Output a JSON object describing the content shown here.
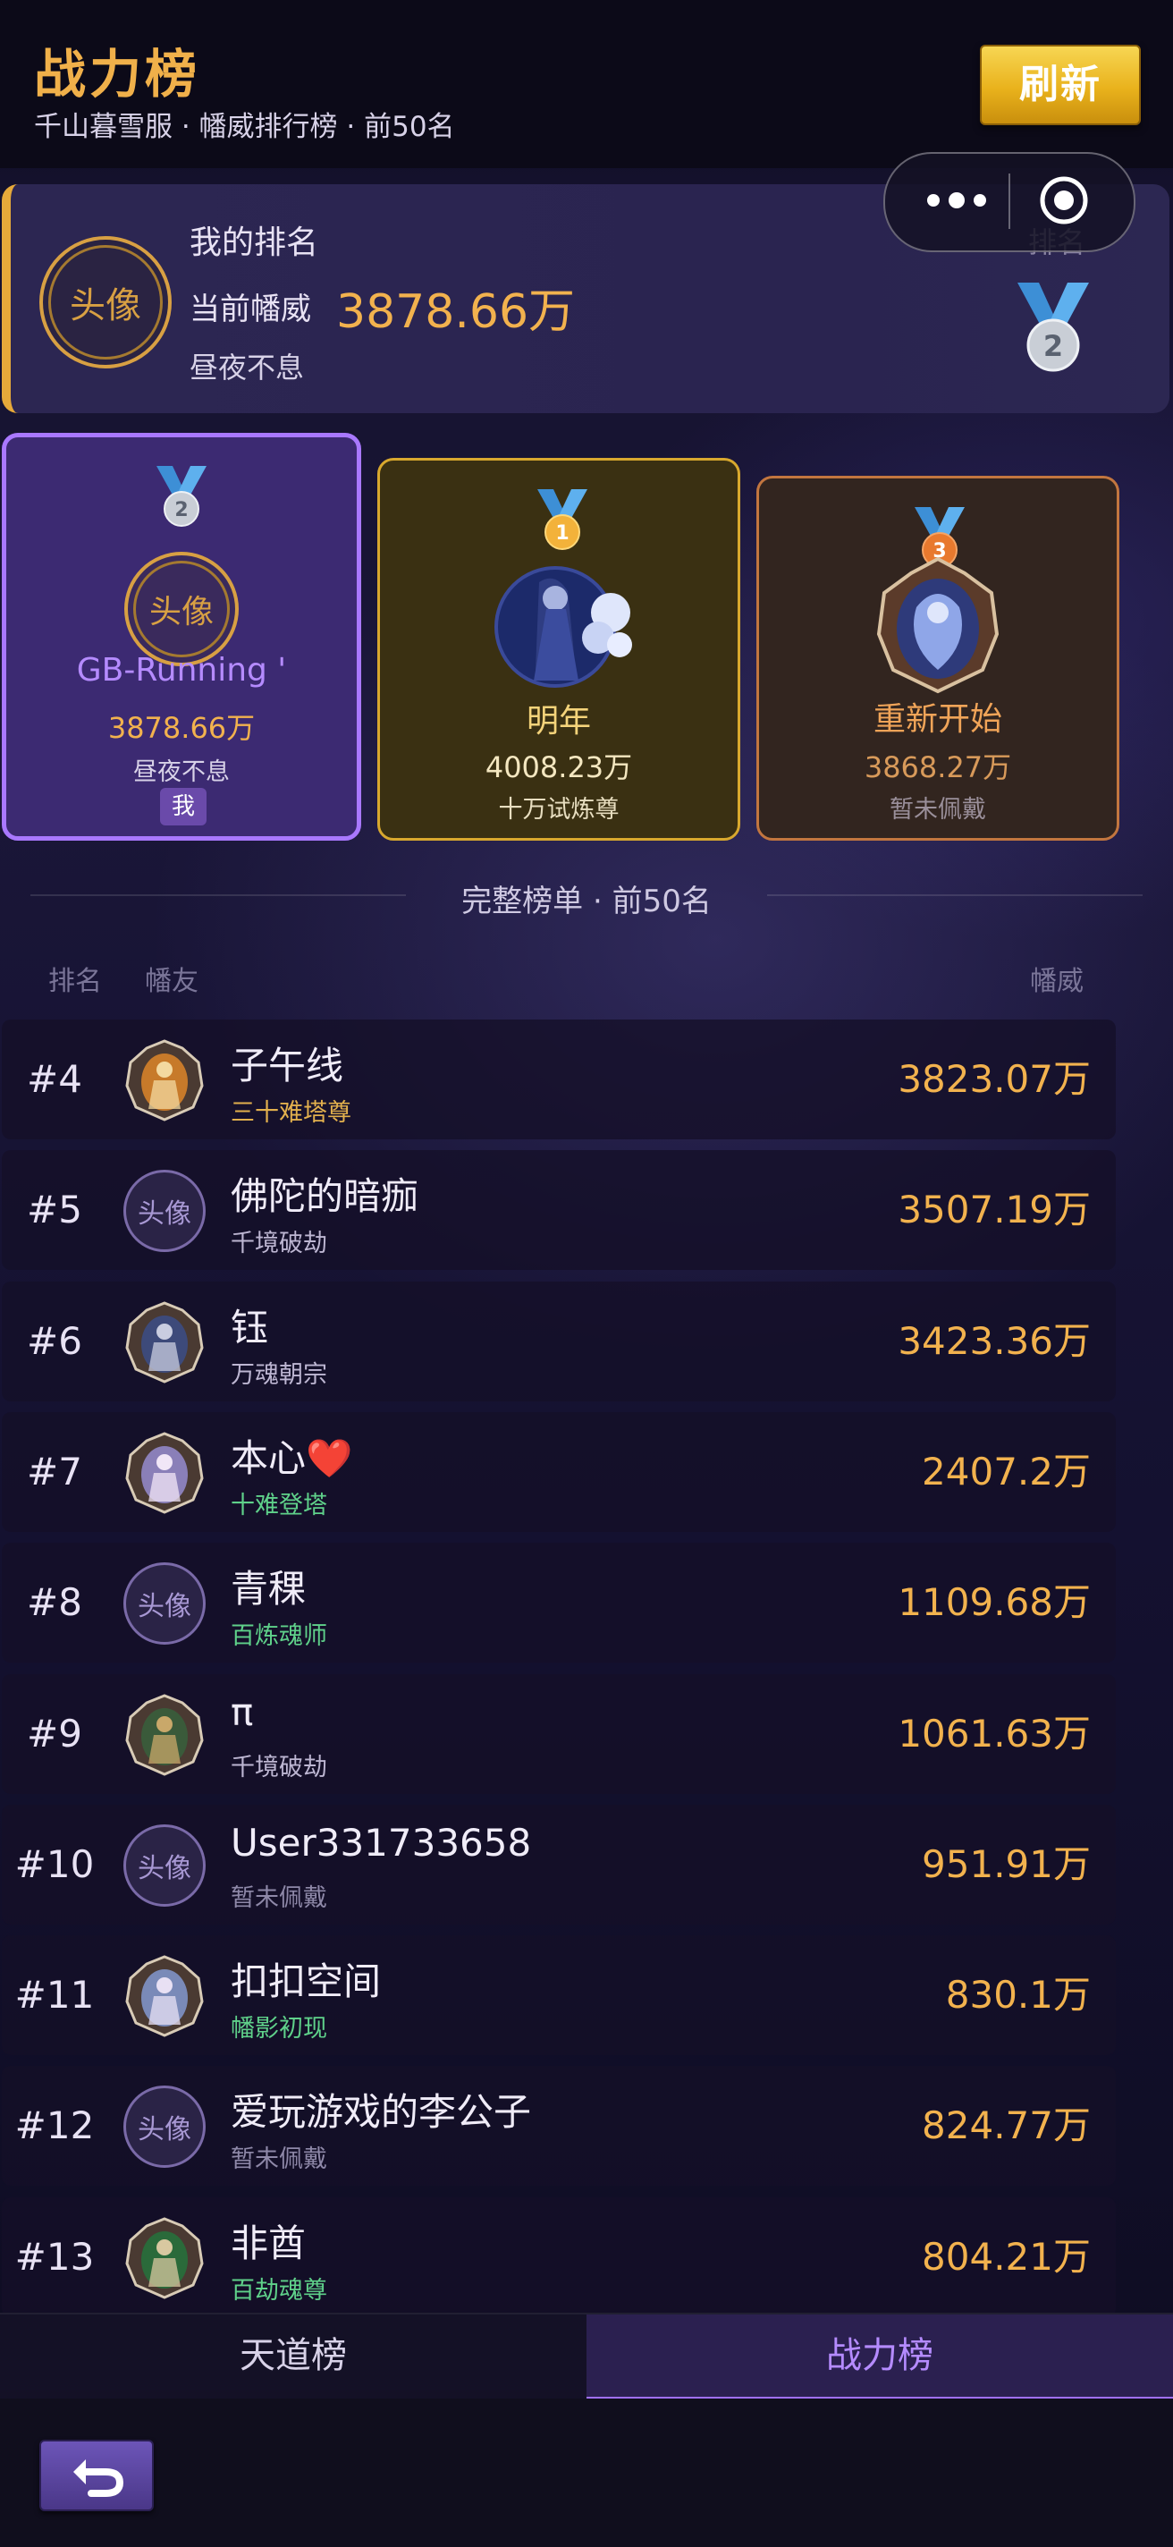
{
  "header": {
    "title": "战力榜",
    "subtitle": "千山暮雪服 · 幡威排行榜 · 前50名",
    "refresh_label": "刷新"
  },
  "my_rank": {
    "label": "我的排名",
    "power_label": "当前幡威",
    "power_value": "3878.66万",
    "title": "昼夜不息",
    "avatar_text": "头像",
    "rank_label": "排名",
    "rank_number": "2"
  },
  "podium": [
    {
      "rank": "2",
      "name": "GB-Running '",
      "power": "3878.66万",
      "title": "昼夜不息",
      "avatar_text": "头像",
      "me_badge": "我"
    },
    {
      "rank": "1",
      "name": "明年",
      "power": "4008.23万",
      "title": "十万试炼尊"
    },
    {
      "rank": "3",
      "name": "重新开始",
      "power": "3868.27万",
      "title": "暂未佩戴"
    }
  ],
  "list": {
    "heading": "完整榜单 · 前50名",
    "col_rank": "排名",
    "col_friend": "幡友",
    "col_power": "幡威",
    "rows": [
      {
        "rank": "#4",
        "name": "子午线",
        "title": "三十难塔尊",
        "power": "3823.07万",
        "avatar": "image",
        "title_color": "#e2b04d"
      },
      {
        "rank": "#5",
        "name": "佛陀的暗痂",
        "title": "千境破劫",
        "power": "3507.19万",
        "avatar": "头像",
        "title_color": "#bdb6d2"
      },
      {
        "rank": "#6",
        "name": "钰",
        "title": "万魂朝宗",
        "power": "3423.36万",
        "avatar": "image",
        "title_color": "#bdb6d2"
      },
      {
        "rank": "#7",
        "name": "本心❤️",
        "title": "十难登塔",
        "power": "2407.2万",
        "avatar": "image",
        "title_color": "#5fd18a"
      },
      {
        "rank": "#8",
        "name": "青稞",
        "title": "百炼魂师",
        "power": "1109.68万",
        "avatar": "头像",
        "title_color": "#5fd18a"
      },
      {
        "rank": "#9",
        "name": "π",
        "title": "千境破劫",
        "power": "1061.63万",
        "avatar": "image",
        "title_color": "#bdb6d2"
      },
      {
        "rank": "#10",
        "name": "User331733658",
        "title": "暂未佩戴",
        "power": "951.91万",
        "avatar": "头像",
        "title_color": "#8e88a8"
      },
      {
        "rank": "#11",
        "name": "扣扣空间",
        "title": "幡影初现",
        "power": "830.1万",
        "avatar": "image",
        "title_color": "#5fd18a"
      },
      {
        "rank": "#12",
        "name": "爱玩游戏的李公子",
        "title": "暂未佩戴",
        "power": "824.77万",
        "avatar": "头像",
        "title_color": "#8e88a8"
      },
      {
        "rank": "#13",
        "name": "非酋",
        "title": "百劫魂尊",
        "power": "804.21万",
        "avatar": "image",
        "title_color": "#5fd18a"
      }
    ]
  },
  "tabs": [
    {
      "label": "天道榜",
      "active": false
    },
    {
      "label": "战力榜",
      "active": true
    }
  ],
  "colors": {
    "accent_gold": "#f2b24e",
    "accent_purple": "#a978ff",
    "title_green": "#5fd18a"
  }
}
